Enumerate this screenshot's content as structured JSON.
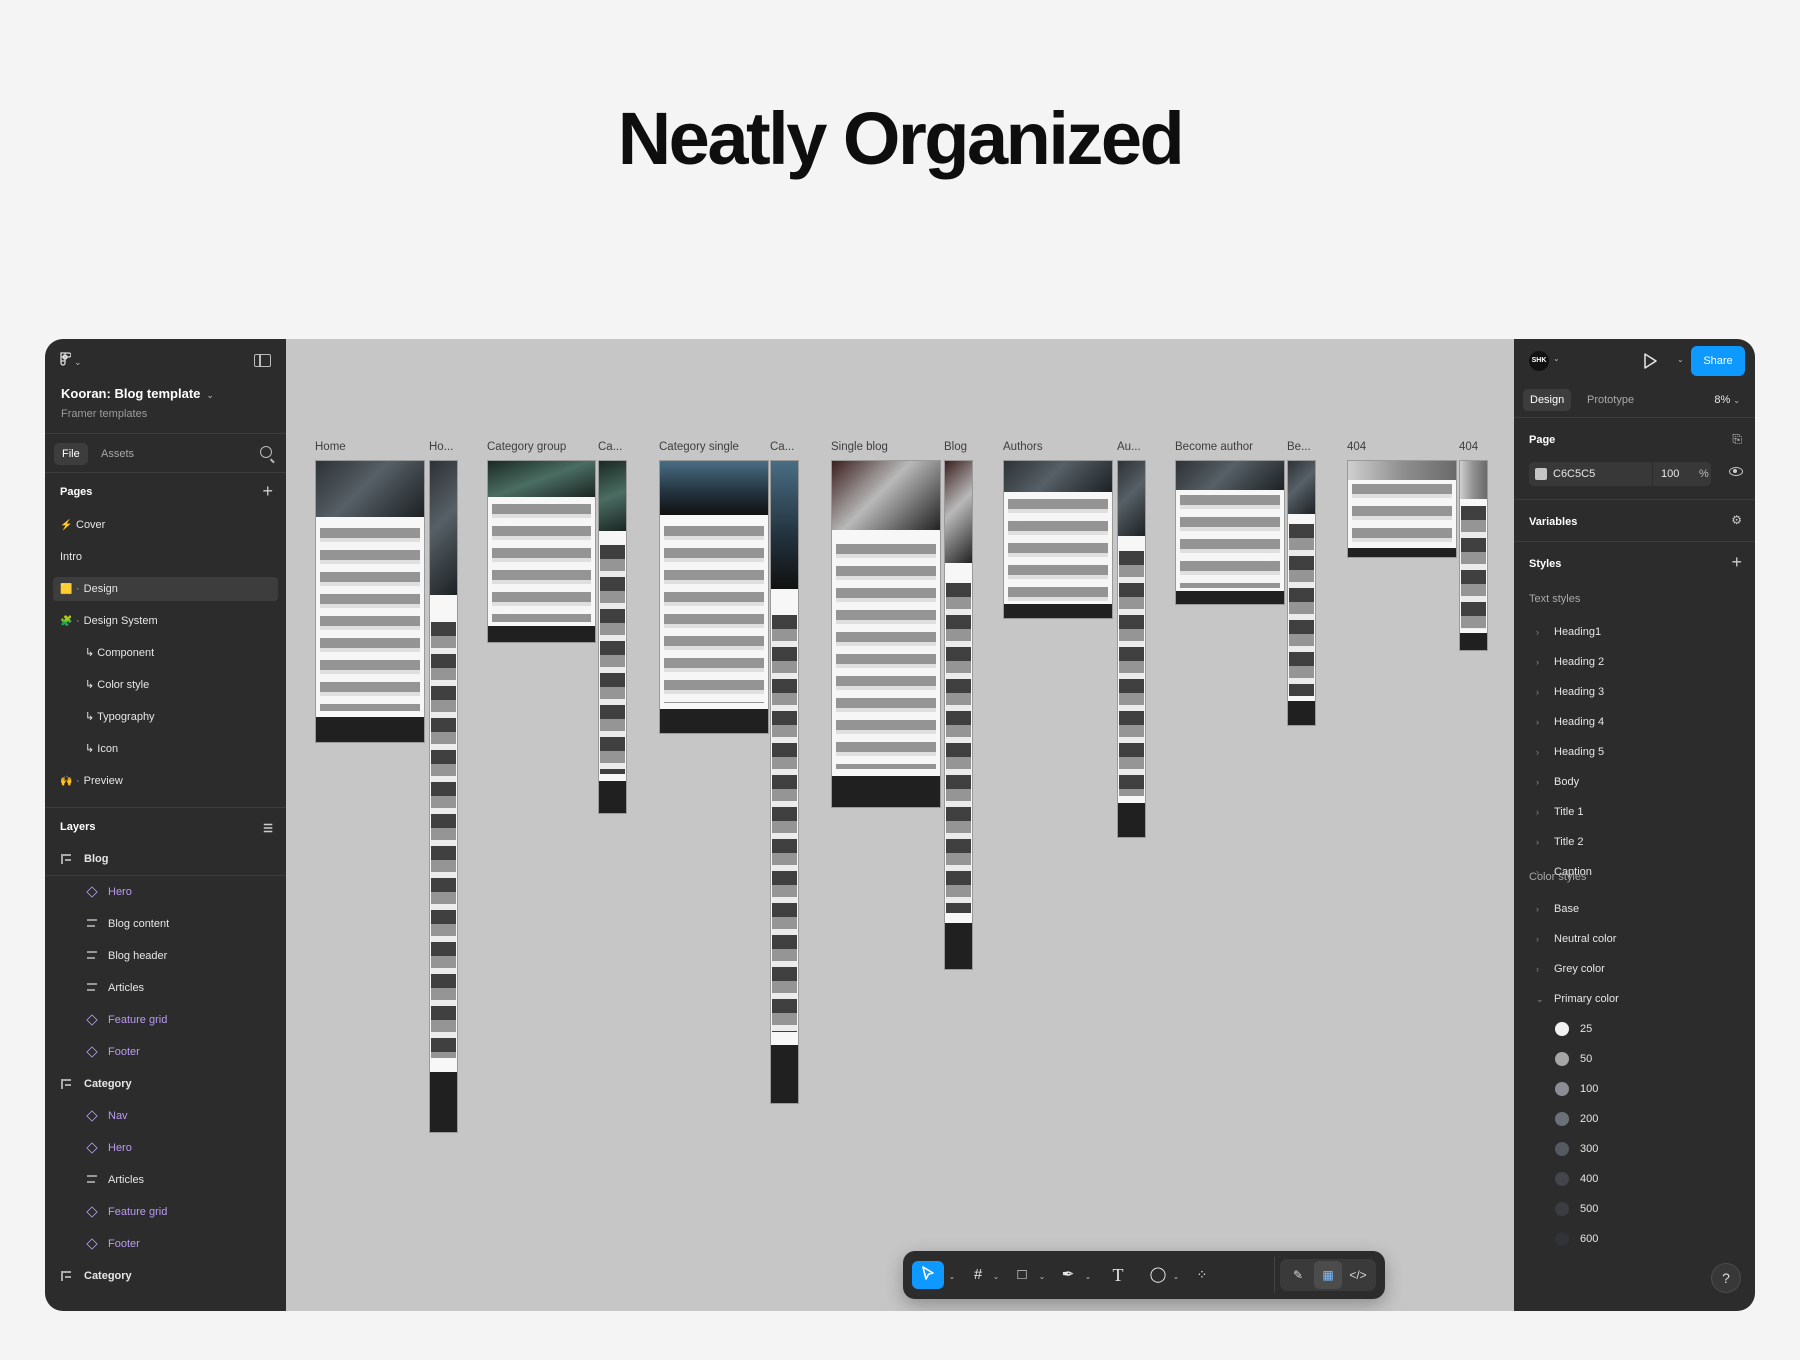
{
  "headline": "Neatly Organized",
  "left_panel": {
    "file_title": "Kooran: Blog template",
    "file_subtitle": "Framer templates",
    "tabs": [
      "File",
      "Assets"
    ],
    "pages_title": "Pages",
    "pages": [
      {
        "emoji": "⚡",
        "label": "Cover",
        "sub": false
      },
      {
        "emoji": "",
        "label": "Intro",
        "sub": false
      },
      {
        "emoji": "🟨",
        "label": "Design",
        "sub": false,
        "selected": true,
        "dot": true
      },
      {
        "emoji": "🧩",
        "label": "Design System",
        "sub": false,
        "dot": true
      },
      {
        "emoji": "",
        "label": "↳ Component",
        "sub": true
      },
      {
        "emoji": "",
        "label": "↳ Color style",
        "sub": true
      },
      {
        "emoji": "",
        "label": "↳ Typography",
        "sub": true
      },
      {
        "emoji": "",
        "label": "↳ Icon",
        "sub": true
      },
      {
        "emoji": "🙌",
        "label": "Preview",
        "sub": false,
        "dot": true
      }
    ],
    "layers_title": "Layers",
    "layers": [
      {
        "label": "Blog",
        "kind": "frame"
      },
      {
        "label": "Hero",
        "kind": "component"
      },
      {
        "label": "Blog content",
        "kind": "stack"
      },
      {
        "label": "Blog header",
        "kind": "stack"
      },
      {
        "label": "Articles",
        "kind": "stack"
      },
      {
        "label": "Feature grid",
        "kind": "component"
      },
      {
        "label": "Footer",
        "kind": "component"
      },
      {
        "label": "Category",
        "kind": "frame"
      },
      {
        "label": "Nav",
        "kind": "component"
      },
      {
        "label": "Hero",
        "kind": "component"
      },
      {
        "label": "Articles",
        "kind": "stack"
      },
      {
        "label": "Feature grid",
        "kind": "component"
      },
      {
        "label": "Footer",
        "kind": "component"
      },
      {
        "label": "Category",
        "kind": "frame"
      }
    ]
  },
  "canvas": {
    "frame_labels": [
      "Home",
      "Ho...",
      "Category group",
      "Ca...",
      "Category single",
      "Ca...",
      "Single blog",
      "Blog",
      "Authors",
      "Au...",
      "Become author",
      "Be...",
      "404",
      "404"
    ]
  },
  "toolbar": {
    "tools": [
      "move-tool",
      "frame-tool",
      "shape-tool",
      "pen-tool",
      "text-tool",
      "comment-tool",
      "actions-tool"
    ],
    "modes": [
      "draw-mode",
      "design-mode",
      "dev-mode"
    ]
  },
  "right_panel": {
    "avatar_initials": "SHK",
    "share_label": "Share",
    "tabs": [
      "Design",
      "Prototype"
    ],
    "zoom": "8%",
    "page_title": "Page",
    "page_fill_hex": "C6C5C5",
    "page_fill_opacity": "100",
    "page_fill_pct": "%",
    "variables_title": "Variables",
    "styles_title": "Styles",
    "text_styles_title": "Text styles",
    "text_styles": [
      "Heading1",
      "Heading 2",
      "Heading 3",
      "Heading 4",
      "Heading 5",
      "Body",
      "Title 1",
      "Title 2",
      "Caption"
    ],
    "color_styles_title": "Color styles",
    "color_groups": [
      "Base",
      "Neutral color",
      "Grey color",
      "Primary color"
    ],
    "primary_colors": [
      {
        "label": "25",
        "color": "#f2f2f2"
      },
      {
        "label": "50",
        "color": "#a6a6a6"
      },
      {
        "label": "100",
        "color": "#8a8d93"
      },
      {
        "label": "200",
        "color": "#6c7079"
      },
      {
        "label": "300",
        "color": "#555962"
      },
      {
        "label": "400",
        "color": "#43464d"
      },
      {
        "label": "500",
        "color": "#3a3c42"
      },
      {
        "label": "600",
        "color": "#313338"
      }
    ],
    "help_label": "?"
  },
  "colors": {
    "accent": "#0d99ff",
    "canvas_bg": "#c6c6c6",
    "panel_bg": "#2c2c2c",
    "component_purple": "#b99bf0"
  }
}
